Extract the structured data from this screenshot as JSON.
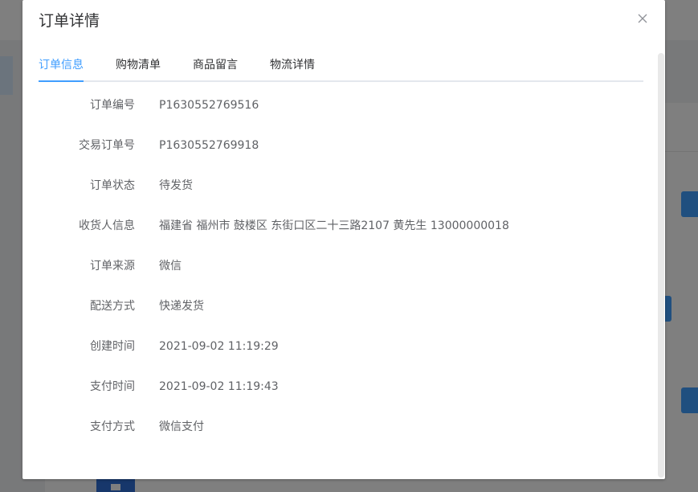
{
  "dialog": {
    "title": "订单详情"
  },
  "tabs": [
    {
      "label": "订单信息",
      "active": true
    },
    {
      "label": "购物清单",
      "active": false
    },
    {
      "label": "商品留言",
      "active": false
    },
    {
      "label": "物流详情",
      "active": false
    }
  ],
  "order": {
    "rows": [
      {
        "label": "订单编号",
        "value": "P1630552769516"
      },
      {
        "label": "交易订单号",
        "value": "P1630552769918"
      },
      {
        "label": "订单状态",
        "value": "待发货"
      },
      {
        "label": "收货人信息",
        "value": "福建省 福州市 鼓楼区 东街口区二十三路2107 黄先生 13000000018"
      },
      {
        "label": "订单来源",
        "value": "微信"
      },
      {
        "label": "配送方式",
        "value": "快递发货"
      },
      {
        "label": "创建时间",
        "value": "2021-09-02 11:19:29"
      },
      {
        "label": "支付时间",
        "value": "2021-09-02 11:19:43"
      },
      {
        "label": "支付方式",
        "value": "微信支付"
      }
    ]
  },
  "icons": {
    "close": "close-icon"
  },
  "colors": {
    "accent": "#409eff",
    "text_primary": "#303133",
    "text_regular": "#606266",
    "overlay": "rgba(0,0,0,0.5)"
  }
}
